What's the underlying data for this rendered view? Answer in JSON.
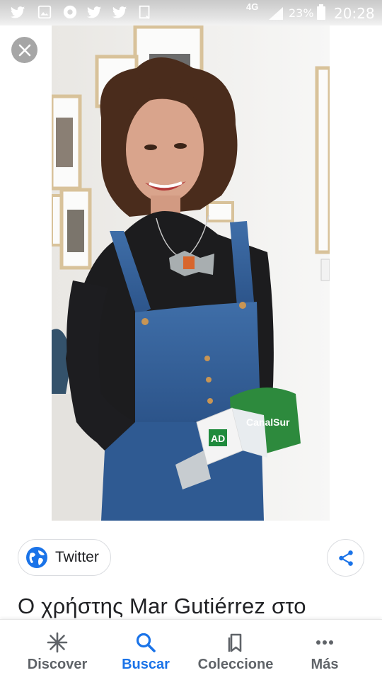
{
  "status_bar": {
    "network": "4G",
    "battery": "23%",
    "time": "20:28"
  },
  "viewer": {
    "close_icon": "close-icon",
    "image_description_visible": false
  },
  "source": {
    "label": "Twitter",
    "icon": "globe-icon"
  },
  "share": {
    "icon": "share-icon"
  },
  "caption": "Ο χρήστης Mar Gutiérrez στο",
  "nav": {
    "items": [
      {
        "label": "Discover",
        "icon": "asterisk-icon",
        "active": false
      },
      {
        "label": "Buscar",
        "icon": "search-icon",
        "active": true
      },
      {
        "label": "Coleccione",
        "icon": "bookmarks-icon",
        "active": false
      },
      {
        "label": "Más",
        "icon": "more-icon",
        "active": false
      }
    ]
  },
  "colors": {
    "accent": "#1a73e8",
    "nav_inactive": "#5f6368",
    "globe": "#1a73e8",
    "close_bg": "#a6a6a6"
  },
  "photo": {
    "mic_brand": "CanalSur",
    "mic_label": "AD"
  }
}
